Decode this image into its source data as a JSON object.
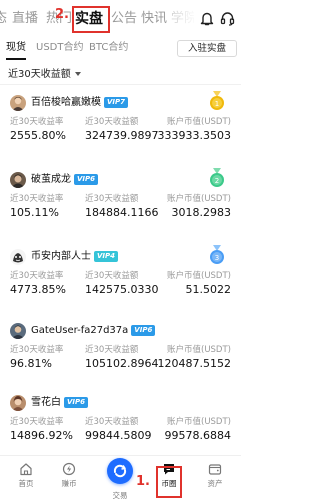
{
  "nav": {
    "tabs": [
      {
        "label": "态"
      },
      {
        "label": "直播"
      },
      {
        "label": "热门"
      },
      {
        "label": "实盘"
      },
      {
        "label": "公告"
      },
      {
        "label": "快讯"
      },
      {
        "label": "学院"
      }
    ],
    "active_tab": "实盘",
    "step_marker": "2."
  },
  "subtabs": {
    "items": [
      {
        "label": "现货"
      },
      {
        "label": "USDT合约"
      },
      {
        "label": "BTC合约"
      }
    ],
    "join_label": "入驻实盘"
  },
  "filter": {
    "label": "近30天收益额"
  },
  "traders": [
    {
      "name": "百倍梭哈赢嫩模",
      "vip": "VIP7",
      "rank": "1",
      "labels": [
        "近30天收益率",
        "近30天收益额",
        "账户币值(USDT)"
      ],
      "values": [
        "2555.80%",
        "324739.9897",
        "333933.3503"
      ]
    },
    {
      "name": "破茧成龙",
      "vip": "VIP6",
      "rank": "2",
      "labels": [
        "近30天收益率",
        "近30天收益额",
        "账户币值(USDT)"
      ],
      "values": [
        "105.11%",
        "184884.1166",
        "3018.2983"
      ]
    },
    {
      "name": "币安内部人士",
      "vip": "VIP4",
      "rank": "3",
      "labels": [
        "近30天收益率",
        "近30天收益额",
        "账户币值(USDT)"
      ],
      "values": [
        "4773.85%",
        "142575.0330",
        "51.5022"
      ]
    },
    {
      "name": "GateUser-fa27d37a",
      "vip": "VIP6",
      "rank": "",
      "labels": [
        "近30天收益率",
        "近30天收益额",
        "账户币值(USDT)"
      ],
      "values": [
        "96.81%",
        "105102.8964",
        "120487.5152"
      ]
    },
    {
      "name": "雪花白",
      "vip": "VIP6",
      "rank": "",
      "labels": [
        "近30天收益率",
        "近30天收益额",
        "账户币值(USDT)"
      ],
      "values": [
        "14896.92%",
        "99844.5809",
        "99578.6884"
      ]
    }
  ],
  "bottom_nav": {
    "items": [
      {
        "label": "首页",
        "icon": "home-icon"
      },
      {
        "label": "赚币",
        "icon": "earn-icon"
      },
      {
        "label": "交易",
        "icon": "trade-icon"
      },
      {
        "label": "币圈",
        "icon": "feed-icon"
      },
      {
        "label": "资产",
        "icon": "wallet-icon"
      }
    ],
    "active": "币圈",
    "step_marker": "1."
  },
  "colors": {
    "annotation_red": "#e0322c",
    "brand_blue": "#1e6cff",
    "vip_blue": "#2b9ae8",
    "vip4_teal": "#35c4d8",
    "gold": "#f0b90b",
    "green_medal": "#3cc98a",
    "blue_medal": "#4a9df5"
  }
}
